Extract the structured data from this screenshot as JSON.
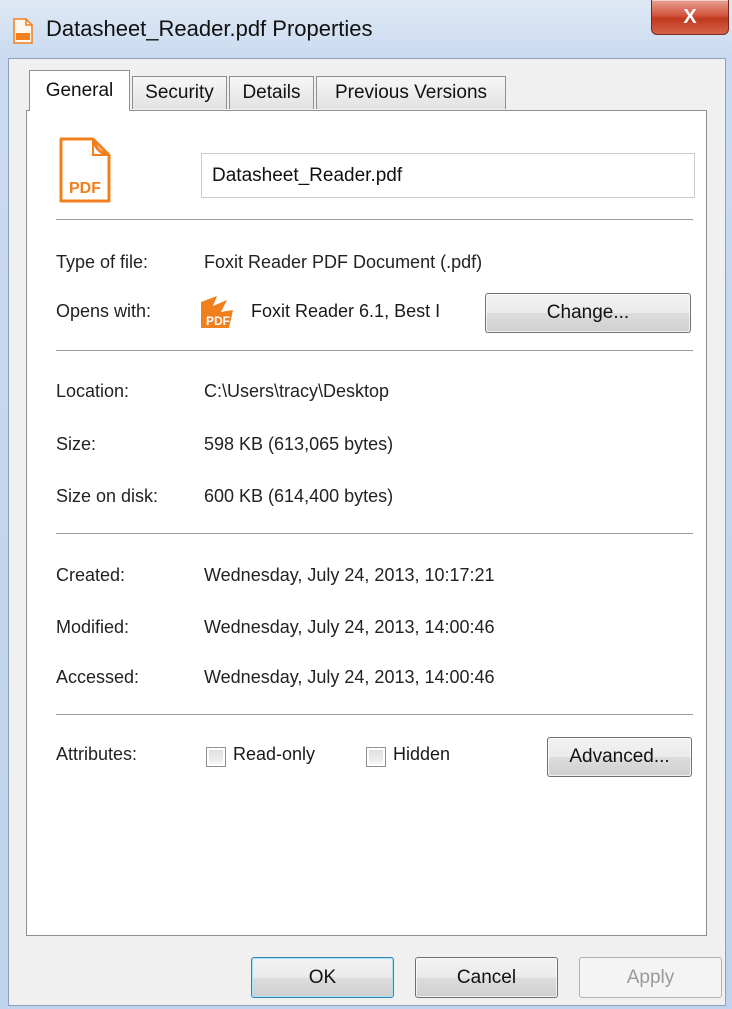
{
  "window": {
    "title": "Datasheet_Reader.pdf Properties",
    "close_symbol": "X",
    "title_icon": "pdf-file-icon"
  },
  "tabs": [
    {
      "label": "General",
      "active": true
    },
    {
      "label": "Security",
      "active": false
    },
    {
      "label": "Details",
      "active": false
    },
    {
      "label": "Previous Versions",
      "active": false
    }
  ],
  "general": {
    "file_icon_text": "PDF",
    "filename": "Datasheet_Reader.pdf",
    "type_of_file": {
      "label": "Type of file:",
      "value": "Foxit Reader PDF Document (.pdf)"
    },
    "opens_with": {
      "label": "Opens with:",
      "value": "Foxit Reader 6.1, Best I",
      "icon_text": "PDF",
      "change_label": "Change..."
    },
    "location": {
      "label": "Location:",
      "value": "C:\\Users\\tracy\\Desktop"
    },
    "size": {
      "label": "Size:",
      "value": "598 KB (613,065 bytes)"
    },
    "size_on_disk": {
      "label": "Size on disk:",
      "value": "600 KB (614,400 bytes)"
    },
    "created": {
      "label": "Created:",
      "value": "Wednesday, July 24, 2013, 10:17:21"
    },
    "modified": {
      "label": "Modified:",
      "value": "Wednesday, July 24, 2013, 14:00:46"
    },
    "accessed": {
      "label": "Accessed:",
      "value": "Wednesday, July 24, 2013, 14:00:46"
    },
    "attributes": {
      "label": "Attributes:",
      "read_only_label": "Read-only",
      "read_only_checked": false,
      "hidden_label": "Hidden",
      "hidden_checked": false,
      "advanced_label": "Advanced..."
    }
  },
  "footer": {
    "ok_label": "OK",
    "cancel_label": "Cancel",
    "apply_label": "Apply",
    "apply_enabled": false
  },
  "colors": {
    "accent_orange": "#f0801e",
    "close_red": "#c9432b"
  }
}
